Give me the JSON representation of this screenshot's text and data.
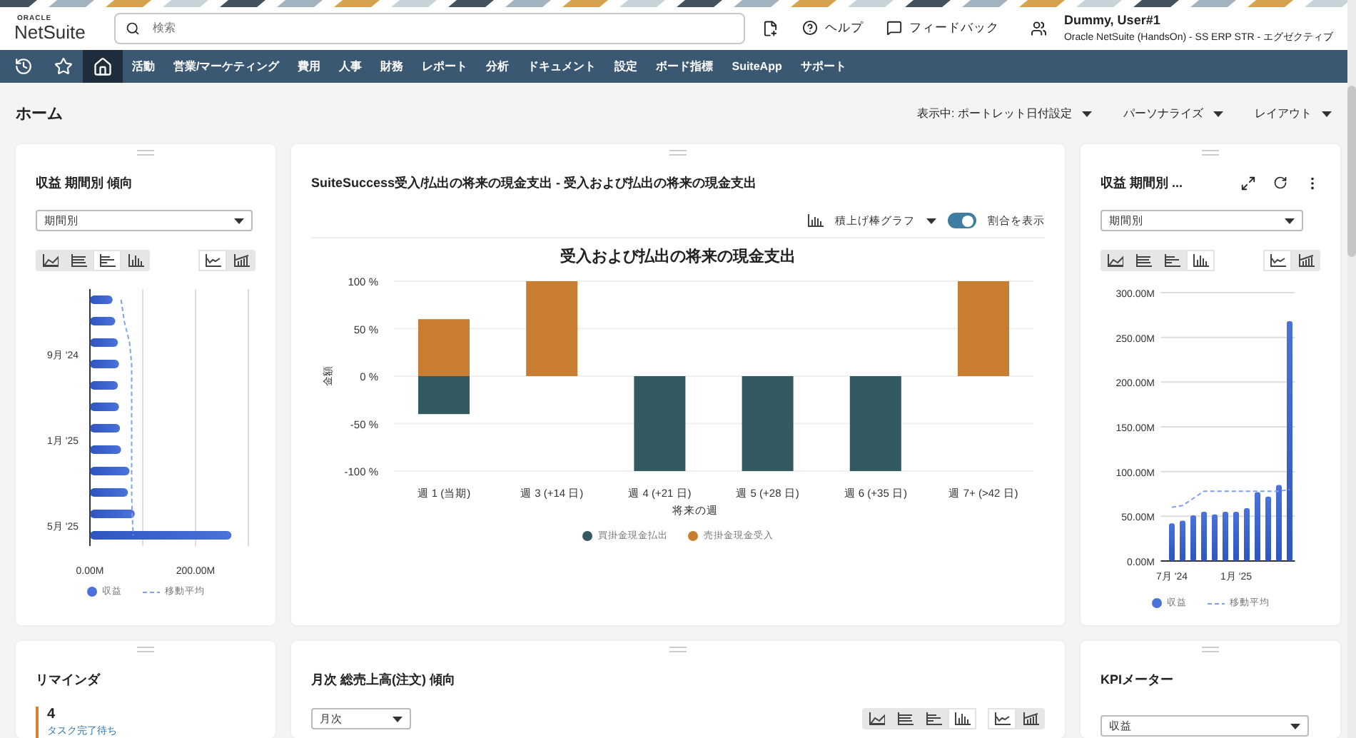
{
  "header": {
    "logo_top": "ORACLE",
    "logo_name": "NetSuite",
    "search": {
      "placeholder": "検索"
    },
    "help": "ヘルプ",
    "feedback": "フィードバック",
    "user_name": "Dummy, User#1",
    "user_role": "Oracle NetSuite (HandsOn) - SS ERP STR - エグゼクティブ"
  },
  "nav": {
    "icons": [
      {
        "kind": "history",
        "selected": false
      },
      {
        "kind": "star",
        "selected": false
      },
      {
        "kind": "home",
        "selected": true
      }
    ],
    "items": [
      "活動",
      "営業/マーケティング",
      "費用",
      "人事",
      "財務",
      "レポート",
      "分析",
      "ドキュメント",
      "設定",
      "ボード指標",
      "SuiteApp",
      "サポート"
    ]
  },
  "page": {
    "title": "ホーム",
    "menus": [
      "表示中: ポートレット日付設定",
      "パーソナライズ",
      "レイアウト"
    ]
  },
  "revenue_left": {
    "title": "収益 期間別 傾向",
    "select": "期間別",
    "chart_type_buttons": [
      {
        "kind": "area",
        "selected": false
      },
      {
        "kind": "stacked",
        "selected": false
      },
      {
        "kind": "hbar",
        "selected": true
      },
      {
        "kind": "vbar",
        "selected": false
      }
    ],
    "overlay_buttons": [
      {
        "kind": "line",
        "selected": true
      },
      {
        "kind": "linebar",
        "selected": false
      }
    ],
    "chart_data": {
      "type": "bar",
      "orientation": "horizontal",
      "categories": [
        null,
        null,
        null,
        "9月 '24",
        null,
        null,
        null,
        "1月 '25",
        null,
        null,
        null,
        "5月 '25"
      ],
      "xlim": [
        0,
        300
      ],
      "grid": true,
      "xticks": [
        {
          "value": 0,
          "label": "0.00M"
        },
        {
          "value": 200,
          "label": "200.00M"
        }
      ],
      "series": [
        {
          "name": "収益",
          "color": "#4a72d8",
          "values": [
            43,
            48,
            53,
            55,
            53,
            55,
            57,
            59,
            75,
            72,
            85,
            268
          ]
        },
        {
          "name": "移動平均",
          "color": "#7fa2f0",
          "type": "line",
          "line_style": "dashed",
          "values": [
            59,
            65,
            75,
            79,
            79,
            79,
            79,
            79,
            79,
            79,
            80,
            82
          ]
        }
      ]
    }
  },
  "cash_flow": {
    "title": "SuiteSuccess受入/払出の将来の現金支出 - 受入および払出の将来の現金支出",
    "chart_type": "積上げ棒グラフ",
    "toggle": {
      "label": "割合を表示",
      "on": true
    },
    "chart_data": {
      "type": "bar",
      "stacked": true,
      "grid": true,
      "title": "受入および払出の将来の現金支出",
      "xlabel": "将来の週",
      "ylabel": "金額",
      "categories": [
        "週 1 (当期)",
        "週 3 (+14 日)",
        "週 4 (+21 日)",
        "週 5 (+28 日)",
        "週 6 (+35 日)",
        "週 7+ (>42 日)"
      ],
      "ylim": [
        -100,
        100
      ],
      "yticks": [
        {
          "value": 100,
          "label": "100 %"
        },
        {
          "value": 50,
          "label": "50 %"
        },
        {
          "value": 0,
          "label": "0 %"
        },
        {
          "value": -50,
          "label": "-50 %"
        },
        {
          "value": -100,
          "label": "-100 %"
        }
      ],
      "series": [
        {
          "name": "買掛金現金払出",
          "color": "#335a60",
          "values": [
            -40,
            0,
            -100,
            -100,
            -100,
            0
          ]
        },
        {
          "name": "売掛金現金受入",
          "color": "#c97d30",
          "values": [
            60,
            100,
            0,
            0,
            0,
            100
          ]
        }
      ]
    }
  },
  "revenue_right": {
    "title": "収益 期間別 ...",
    "select": "期間別",
    "chart_type_buttons": [
      {
        "kind": "area",
        "selected": false
      },
      {
        "kind": "stacked",
        "selected": false
      },
      {
        "kind": "hbar",
        "selected": false
      },
      {
        "kind": "vbar",
        "selected": true
      }
    ],
    "overlay_buttons": [
      {
        "kind": "line",
        "selected": true
      },
      {
        "kind": "linebar",
        "selected": false
      }
    ],
    "chart_data": {
      "type": "bar",
      "orientation": "vertical",
      "categories": [
        "7月 '24",
        null,
        null,
        null,
        null,
        null,
        "1月 '25",
        null,
        null,
        null,
        null,
        null
      ],
      "ylim": [
        0,
        300
      ],
      "grid": true,
      "yticks": [
        {
          "value": 0,
          "label": "0.00M"
        },
        {
          "value": 50,
          "label": "50.00M"
        },
        {
          "value": 100,
          "label": "100.00M"
        },
        {
          "value": 150,
          "label": "150.00M"
        },
        {
          "value": 200,
          "label": "200.00M"
        },
        {
          "value": 250,
          "label": "250.00M"
        },
        {
          "value": 300,
          "label": "300.00M"
        }
      ],
      "series": [
        {
          "name": "収益",
          "color": "#4a72d8",
          "values": [
            42,
            45,
            51,
            55,
            52,
            55,
            55,
            59,
            77,
            72,
            85,
            268
          ]
        },
        {
          "name": "移動平均",
          "color": "#7fa2f0",
          "type": "line",
          "line_style": "dashed",
          "values": [
            60,
            62,
            70,
            78,
            78,
            78,
            78,
            78,
            78,
            78,
            78,
            80
          ]
        }
      ]
    }
  },
  "reminders": {
    "title": "リマインダ",
    "items": [
      {
        "count": "4",
        "label": "タスク完了待ち"
      }
    ]
  },
  "monthly": {
    "title": "月次 総売上高(注文) 傾向",
    "select": "月次",
    "chart_type_buttons": [
      {
        "kind": "area",
        "selected": false
      },
      {
        "kind": "stacked",
        "selected": false
      },
      {
        "kind": "hbar",
        "selected": false
      },
      {
        "kind": "vbar",
        "selected": true
      }
    ],
    "overlay_buttons": [
      {
        "kind": "line",
        "selected": true
      },
      {
        "kind": "linebar",
        "selected": false
      }
    ]
  },
  "kpi": {
    "title": "KPIメーター",
    "select": "収益"
  }
}
